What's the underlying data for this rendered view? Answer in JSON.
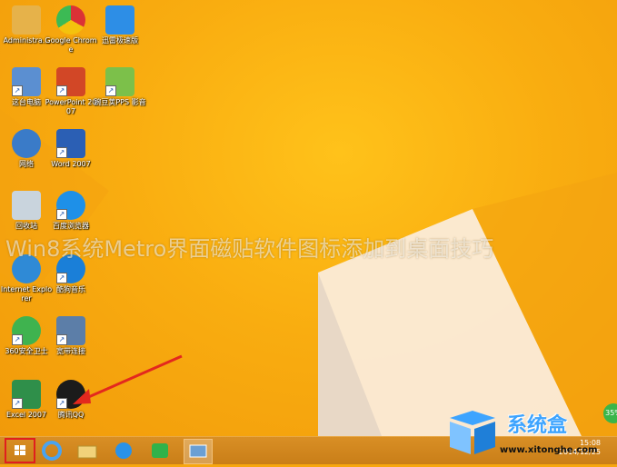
{
  "desktop": {
    "icons": [
      {
        "label": "Administra...",
        "icon": "user-folder-icon"
      },
      {
        "label": "Google Chrome",
        "icon": "chrome-icon"
      },
      {
        "label": "迅雷极速版",
        "icon": "thunder-icon"
      },
      {
        "label": "这台电脑",
        "icon": "computer-icon"
      },
      {
        "label": "PowerPoint 2007",
        "icon": "powerpoint-icon"
      },
      {
        "label": "豌豆荚PPS 影音",
        "icon": "pps-icon"
      },
      {
        "label": "网络",
        "icon": "network-icon"
      },
      {
        "label": "Word 2007",
        "icon": "word-icon"
      },
      {
        "label": "回收站",
        "icon": "recycle-bin-icon"
      },
      {
        "label": "百度浏览器",
        "icon": "baidu-browser-icon"
      },
      {
        "label": "Internet Explorer",
        "icon": "ie-icon"
      },
      {
        "label": "酷狗音乐",
        "icon": "kugou-icon"
      },
      {
        "label": "360安全卫士",
        "icon": "360-icon"
      },
      {
        "label": "宽带连接",
        "icon": "broadband-icon"
      },
      {
        "label": "Excel 2007",
        "icon": "excel-icon"
      },
      {
        "label": "腾讯QQ",
        "icon": "qq-icon"
      }
    ]
  },
  "overlay_title": "Win8系统Metro界面磁贴软件图标添加到桌面技巧",
  "watermark": {
    "brand": "系统盒",
    "url": "www.xitonghe.com"
  },
  "badge": "35%",
  "taskbar": {
    "items": [
      "start-button",
      "ie-icon",
      "explorer-icon",
      "baidu-icon",
      "iqiyi-icon",
      "remote-icon"
    ],
    "time": "15:08",
    "date": "2014/12/25"
  },
  "colors": {
    "wallpaper": "#f9ad10",
    "taskbar": "#cf8620",
    "start_highlight": "#e01e1e"
  }
}
